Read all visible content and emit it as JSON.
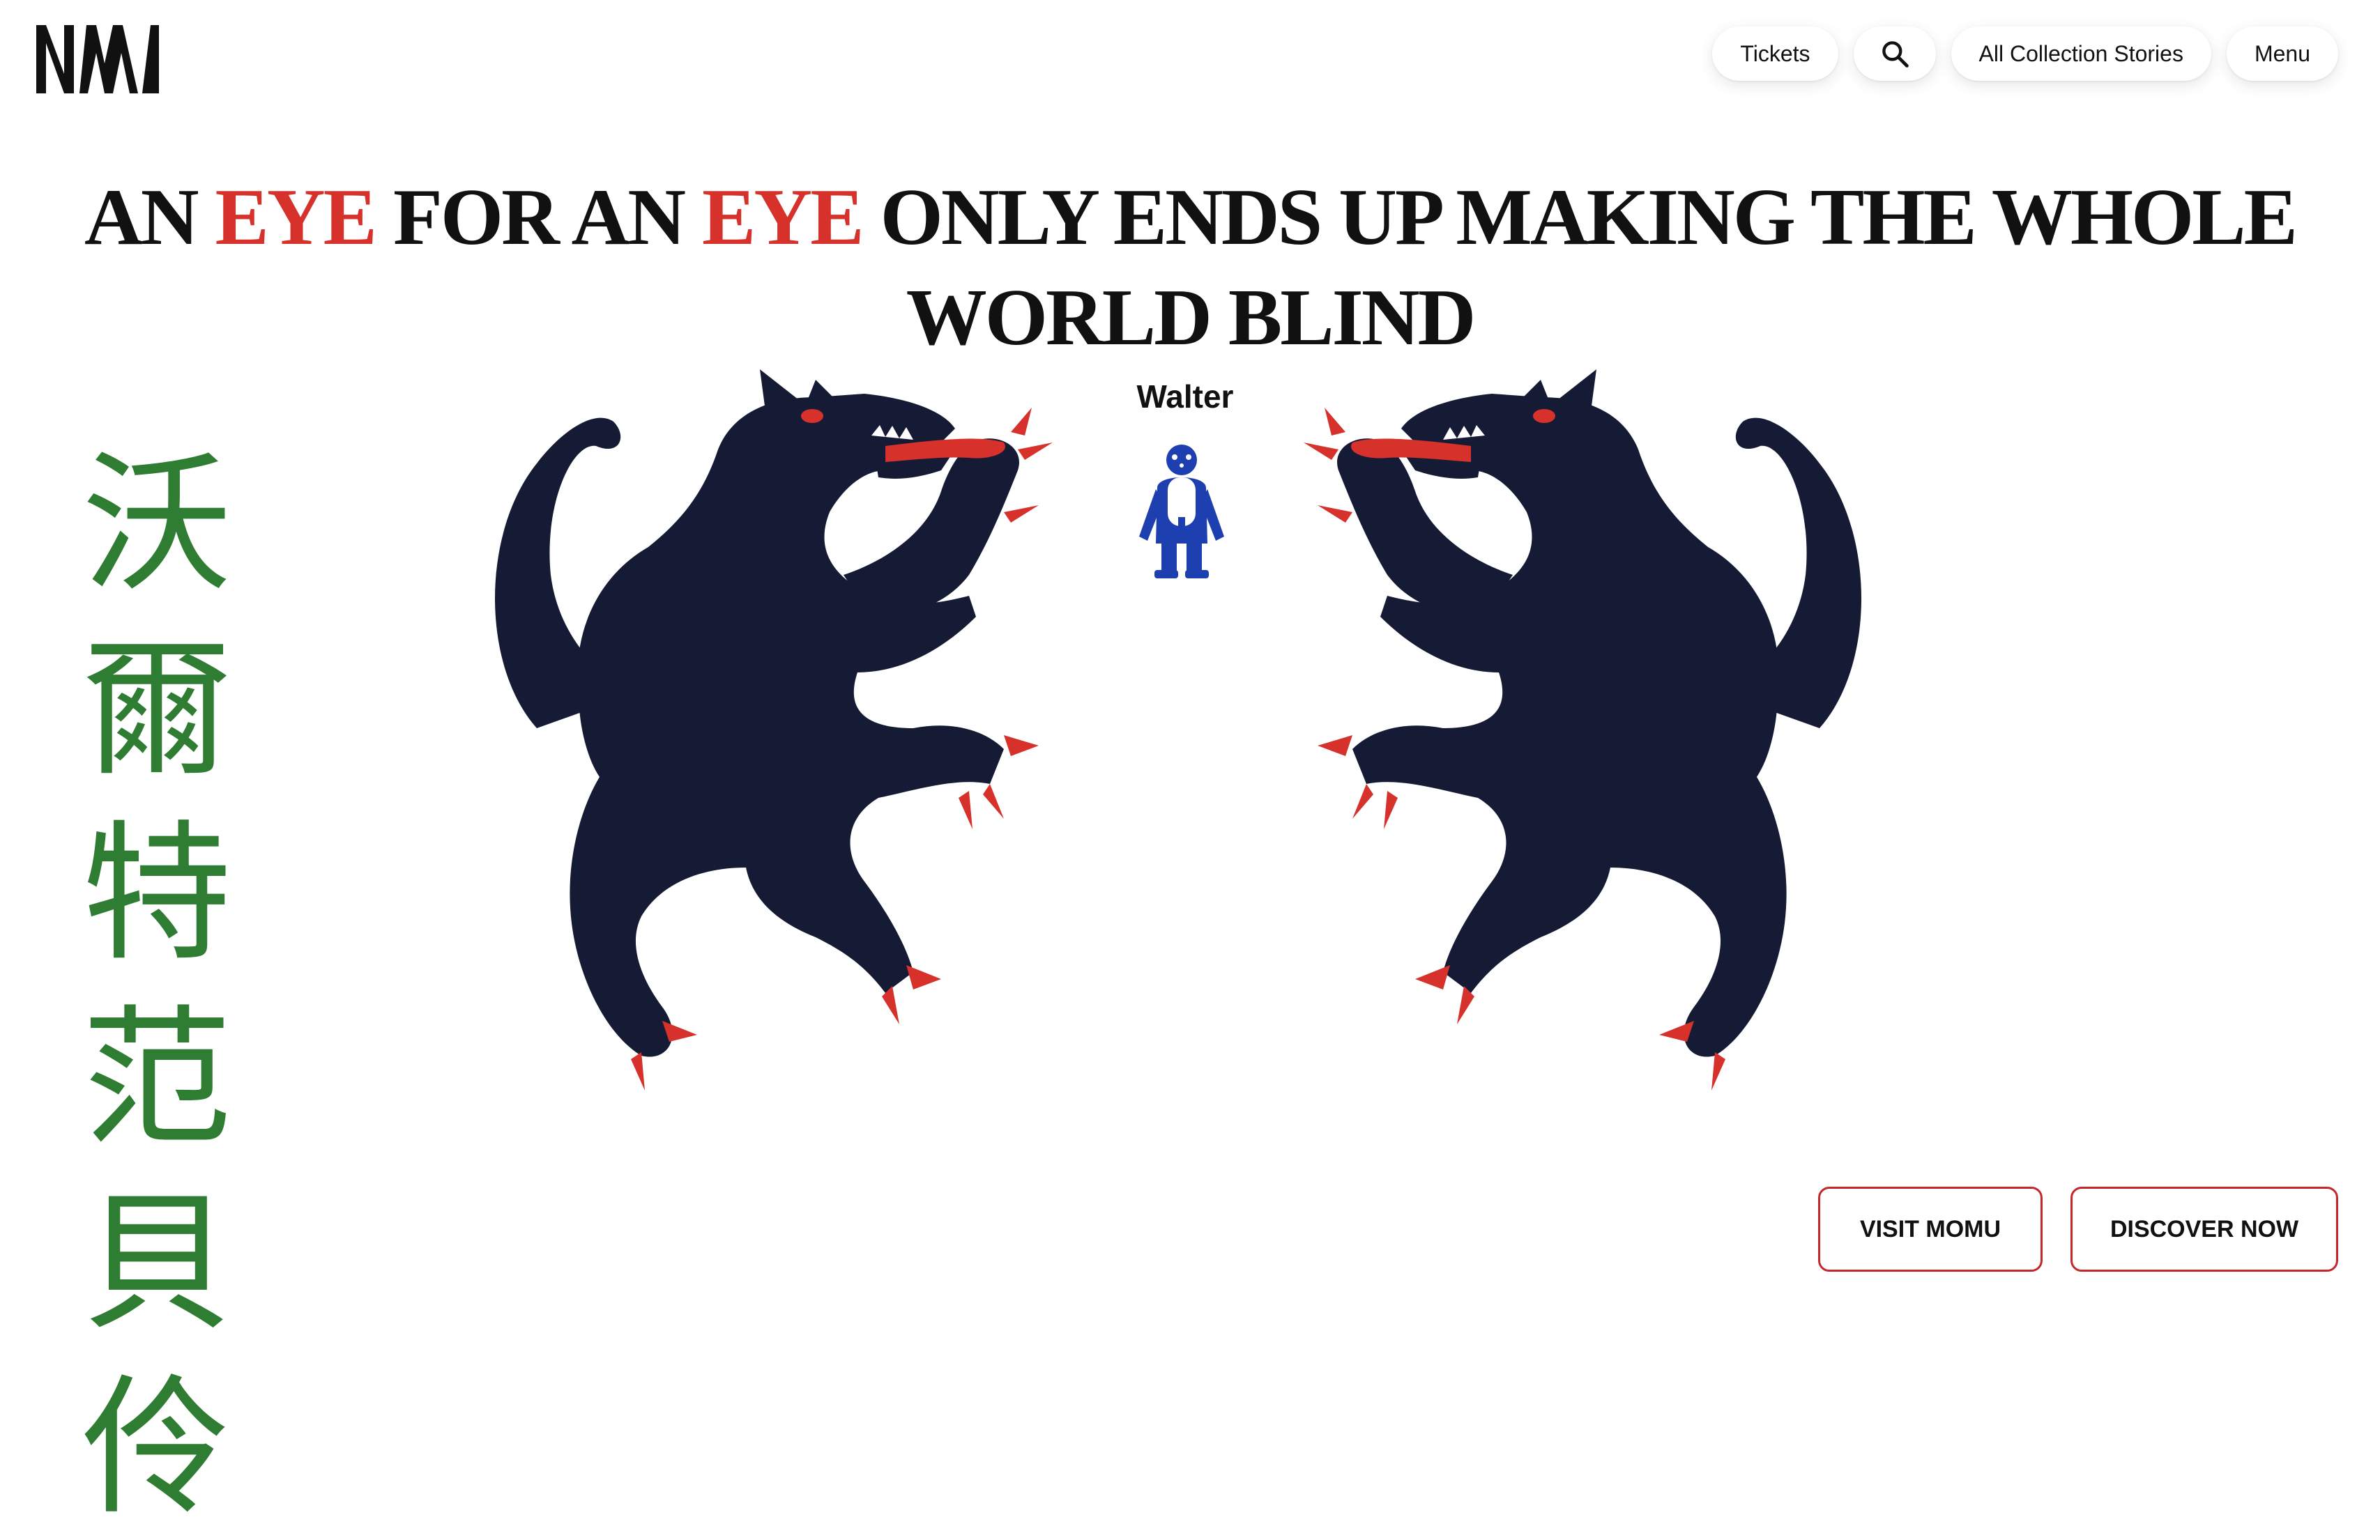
{
  "logo": {
    "text": "MM"
  },
  "nav": {
    "tickets": "Tickets",
    "search_icon": "search-icon",
    "collection": "All Collection Stories",
    "menu": "Menu"
  },
  "headline": {
    "parts": [
      "AN ",
      "EYE",
      " FOR AN ",
      "EYE",
      " ONLY ENDS UP MAKING THE WHOLE WORLD BLIND"
    ]
  },
  "side_title": {
    "chars": [
      "沃",
      "爾",
      "特",
      "范",
      "貝",
      "伶"
    ]
  },
  "figure": {
    "label": "Walter"
  },
  "cta": {
    "visit": "VISIT MOMU",
    "discover": "DISCOVER NOW"
  },
  "colors": {
    "accent_red": "#d6312a",
    "wolf_navy": "#161b35",
    "title_green": "#2f7d32",
    "figure_blue": "#1d3fb0"
  }
}
